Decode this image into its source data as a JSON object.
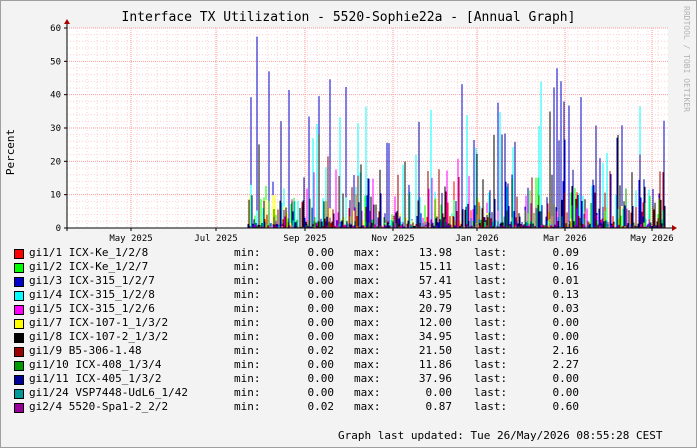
{
  "chart_data": {
    "type": "bar",
    "title": "Interface TX Utilization - 5520-Sophie22a - [Annual Graph]",
    "ylabel": "Percent",
    "ylim": [
      0,
      60
    ],
    "yticks": [
      "0",
      "10",
      "20",
      "30",
      "40",
      "50",
      "60"
    ],
    "xticks": [
      "May 2025",
      "Jul 2025",
      "Sep 2025",
      "Nov 2025",
      "Jan 2026",
      "Mar 2026",
      "May 2026"
    ],
    "grid": true,
    "watermark": "RRDTOOL / TOBI OETIKER",
    "data_start": "Aug 2025",
    "series": [
      {
        "name": "gi1/1 ICX-Ke_1/2/8",
        "color": "#ff0000",
        "min": "0.00",
        "max": "13.98",
        "last": "0.09",
        "peak": 13.98
      },
      {
        "name": "gi1/2 ICX-Ke_1/2/7",
        "color": "#00ff00",
        "min": "0.00",
        "max": "15.11",
        "last": "0.16",
        "peak": 15.11
      },
      {
        "name": "gi1/3 ICX-315_1/2/7",
        "color": "#0000cc",
        "min": "0.00",
        "max": "57.41",
        "last": "0.01",
        "peak": 57.41
      },
      {
        "name": "gi1/4 ICX-315_1/2/8",
        "color": "#00ffff",
        "min": "0.00",
        "max": "43.95",
        "last": "0.13",
        "peak": 43.95
      },
      {
        "name": "gi1/5 ICX-315_1/2/6",
        "color": "#ff00ff",
        "min": "0.00",
        "max": "20.79",
        "last": "0.03",
        "peak": 20.79
      },
      {
        "name": "gi1/7 ICX-107-1_1/3/2",
        "color": "#ffff00",
        "min": "0.00",
        "max": "12.00",
        "last": "0.00",
        "peak": 12.0
      },
      {
        "name": "gi1/8 ICX-107-2_1/3/2",
        "color": "#000000",
        "min": "0.00",
        "max": "34.95",
        "last": "0.00",
        "peak": 34.95
      },
      {
        "name": "gi1/9 B5-306-1.48",
        "color": "#990000",
        "min": "0.02",
        "max": "21.50",
        "last": "2.16",
        "peak": 21.5
      },
      {
        "name": "gi1/10 ICX-408_1/3/4",
        "color": "#009900",
        "min": "0.00",
        "max": "11.86",
        "last": "2.27",
        "peak": 11.86
      },
      {
        "name": "gi1/11 ICX-405_1/3/2",
        "color": "#000099",
        "min": "0.00",
        "max": "37.96",
        "last": "0.00",
        "peak": 37.96
      },
      {
        "name": "gi1/24 VSP7448-UdL6_1/42",
        "color": "#009999",
        "min": "0.00",
        "max": "0.00",
        "last": "0.00",
        "peak": 0.0
      },
      {
        "name": "gi2/4 5520-Spa1-2_2/2",
        "color": "#990099",
        "min": "0.02",
        "max": "0.87",
        "last": "0.60",
        "peak": 0.87
      }
    ]
  },
  "legend_labels": {
    "min": "min:",
    "max": "max:",
    "last": "last:"
  },
  "footer": "Graph last updated: Tue 26/May/2026 08:55:28 CEST"
}
